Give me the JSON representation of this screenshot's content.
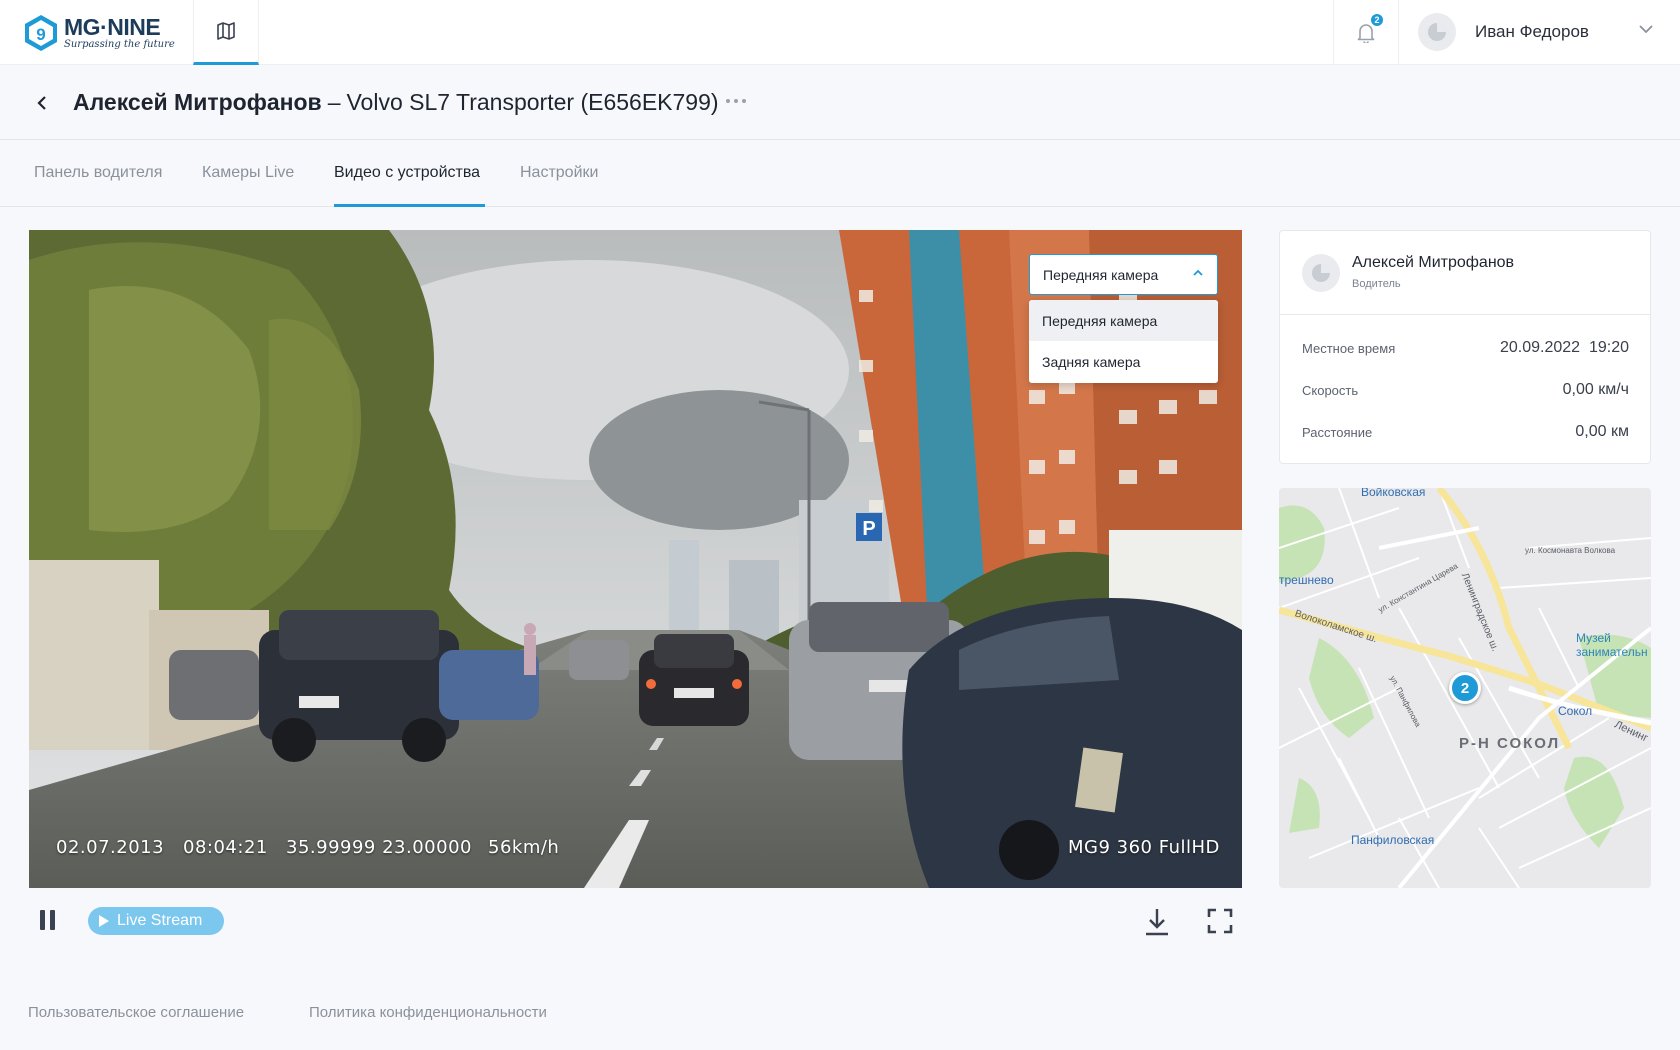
{
  "app": {
    "logo_name": "MG·NINE",
    "logo_tagline": "Surpassing the future"
  },
  "header": {
    "notifications_count": "2",
    "user_name": "Иван Федоров"
  },
  "page": {
    "driver_name": "Алексей Митрофанов",
    "separator": "–",
    "vehicle": "Volvo SL7 Transporter (E656EK799)"
  },
  "tabs": [
    {
      "label": "Панель водителя",
      "active": false
    },
    {
      "label": "Камеры Live",
      "active": false
    },
    {
      "label": "Видео с устройства",
      "active": true
    },
    {
      "label": "Настройки",
      "active": false
    }
  ],
  "video": {
    "osd_date": "02.07.2013",
    "osd_time": "08:04:21",
    "osd_coords": "35.99999 23.00000",
    "osd_speed": "56km/h",
    "osd_device": "MG9 360 FullHD",
    "camera_select": {
      "value": "Передняя камера",
      "options": [
        "Передняя камера",
        "Задняя камера"
      ],
      "selected_index": 0
    }
  },
  "controls": {
    "live_label": "Live Stream"
  },
  "info_card": {
    "name": "Алексей Митрофанов",
    "role": "Водитель",
    "rows": [
      {
        "label": "Местное время",
        "value": "20.09.2022  19:20"
      },
      {
        "label": "Скорость",
        "value": "0,00 км/ч"
      },
      {
        "label": "Расстояние",
        "value": "0,00 км"
      }
    ]
  },
  "map": {
    "metro_voykovskaya": "Войковская",
    "metro_sokol": "Сокол",
    "metro_panfilovskaya": "Панфиловская",
    "metro_left": "трешнево",
    "district": "Р-Н СОКОЛ",
    "museum": "Музей\nзанимательн",
    "road_volokolamskoe": "Волоколамское ш.",
    "road_leningradskoe": "Ленинградское ш.",
    "road_kosmonavta": "ул. Космонавта Волкова",
    "road_tsareva": "ул. Константина Царева",
    "road_panfilova": "ул. Панфилова",
    "road_lenin": "Ленинг",
    "cluster_count": "2"
  },
  "footer": {
    "terms": "Пользовательское соглашение",
    "privacy": "Политика конфиденциональности"
  },
  "colors": {
    "accent": "#1e9bd7",
    "live_button": "#7cc7ee"
  }
}
